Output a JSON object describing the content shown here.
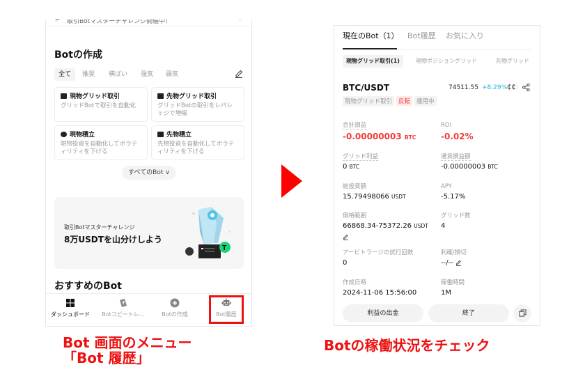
{
  "left_screen": {
    "top_banner": {
      "icon": "flag-icon",
      "text": "取引Botマスターチャレンジ開催中！",
      "arrow": "›"
    },
    "create_section": {
      "title": "Botの作成",
      "filters": [
        {
          "label": "全て",
          "active": true
        },
        {
          "label": "推奨",
          "active": false
        },
        {
          "label": "横ばい",
          "active": false
        },
        {
          "label": "強気",
          "active": false
        },
        {
          "label": "弱気",
          "active": false
        }
      ],
      "edit_icon": "edit-icon",
      "bot_types": [
        {
          "title": "現物グリッド取引",
          "desc": "グリッドBotで取引を自動化",
          "icon": "spot-grid-icon"
        },
        {
          "title": "先物グリッド取引",
          "desc": "グリッドBotの取引をレバレッジで増幅",
          "icon": "futures-grid-icon"
        },
        {
          "title": "現物積立",
          "desc": "現物投資を自動化してボラティリティを下げる",
          "icon": "spot-dca-icon"
        },
        {
          "title": "先物積立",
          "desc": "先物投資を自動化してボラティリティを下げる",
          "icon": "futures-dca-icon"
        }
      ],
      "all_bots_label": "すべてのBot ∨"
    },
    "promo": {
      "subtitle": "取引Botマスターチャレンジ",
      "title": "8万USDTを山分けしよう"
    },
    "recommended_title": "おすすめのBot",
    "bottom_nav": [
      {
        "label": "ダッシュボード",
        "icon": "dashboard-icon",
        "active": true
      },
      {
        "label": "Botコピートレ…",
        "icon": "copy-trade-icon",
        "active": false
      },
      {
        "label": "Botの作成",
        "icon": "plus-circle-icon",
        "active": false
      },
      {
        "label": "Bot履歴",
        "icon": "robot-icon",
        "active": false,
        "highlighted": true
      }
    ]
  },
  "left_caption": {
    "line1": "Bot 画面のメニュー",
    "line2": "「Bot 履歴」"
  },
  "right_screen": {
    "tabs": [
      {
        "label": "現在のBot（1）",
        "active": true
      },
      {
        "label": "Bot履歴",
        "active": false
      },
      {
        "label": "お気に入り",
        "active": false
      }
    ],
    "subtabs": [
      {
        "label": "現物グリッド取引(1)",
        "active": true
      },
      {
        "label": "現物ポジショングリッド",
        "active": false
      },
      {
        "label": "先物グリッド",
        "active": false
      }
    ],
    "bot": {
      "pair": "BTC/USDT",
      "price": "74511.55",
      "change": "+8.29%",
      "tags": [
        {
          "label": "現物グリッド取引",
          "style": "gray"
        },
        {
          "label": "反転",
          "style": "red"
        },
        {
          "label": "運用中",
          "style": "gray"
        }
      ],
      "stats": {
        "total_pnl": {
          "label": "合計損益",
          "value": "-0.00000003",
          "unit": "BTC"
        },
        "roi": {
          "label": "ROI",
          "value": "-0.02%"
        },
        "grid_profit": {
          "label": "グリッド利益",
          "value": "0",
          "unit": "BTC"
        },
        "currency_pnl": {
          "label": "通貨損益額",
          "value": "-0.00000003",
          "unit": "BTC"
        },
        "total_investment": {
          "label": "総投資額",
          "value": "15.79498066",
          "unit": "USDT"
        },
        "apy": {
          "label": "APY",
          "value": "-5.17%"
        },
        "price_range": {
          "label": "価格範囲",
          "value": "66868.34-75372.26",
          "unit": "USDT"
        },
        "grid_count": {
          "label": "グリッド数",
          "value": "4"
        },
        "arbitrage_attempts": {
          "label": "アービトラージの試行回数",
          "value": "0"
        },
        "tp_sl": {
          "label": "利確/損切",
          "value": "--/--"
        },
        "created_at": {
          "label": "作成日時",
          "value": "2024-11-06 15:56:00"
        },
        "running_time": {
          "label": "稼働時間",
          "value": "1M"
        }
      }
    },
    "buttons": {
      "withdraw": "利益の出金",
      "stop": "終了",
      "copy_icon": "copy-icon"
    }
  },
  "right_caption": "Botの稼働状況をチェック",
  "colors": {
    "accent_red": "#ee1111",
    "positive_cyan": "#1db3d8",
    "loss_red": "#f03c3c"
  }
}
